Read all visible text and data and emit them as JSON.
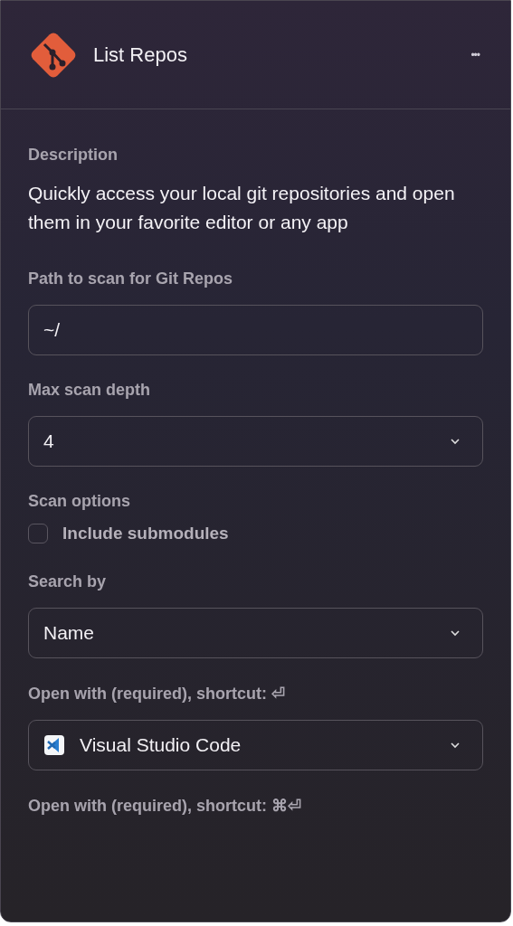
{
  "header": {
    "title": "List Repos",
    "menu": "•••"
  },
  "description": {
    "label": "Description",
    "text": "Quickly access your local git repositories and open them in your favorite editor or any app"
  },
  "sections": [
    {
      "label": "Path to scan for Git Repos",
      "control": {
        "kind": "text",
        "value": "~/"
      }
    },
    {
      "label": "Max scan depth",
      "control": {
        "kind": "select",
        "value": "4"
      }
    },
    {
      "label": "Scan options",
      "control": {
        "kind": "checkbox",
        "text": "Include submodules",
        "checked": false
      }
    },
    {
      "label": "Search by",
      "control": {
        "kind": "select",
        "value": "Name"
      }
    },
    {
      "label": "Open with (required), shortcut: ⏎",
      "control": {
        "kind": "app-select",
        "value": "Visual Studio Code"
      }
    },
    {
      "label": "Open with (required), shortcut: ⌘⏎"
    }
  ]
}
